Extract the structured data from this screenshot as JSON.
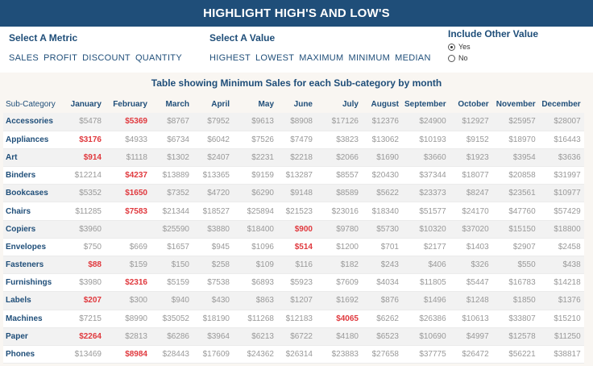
{
  "banner": {
    "title": "HIGHLIGHT HIGH'S AND LOW'S"
  },
  "metric": {
    "title": "Select A Metric",
    "options": [
      "SALES",
      "PROFIT",
      "DISCOUNT",
      "QUANTITY"
    ]
  },
  "value": {
    "title": "Select A Value",
    "options": [
      "HIGHEST",
      "LOWEST",
      "MAXIMUM",
      "MINIMUM",
      "MEDIAN"
    ]
  },
  "other": {
    "title": "Include Other Value",
    "yes": "Yes",
    "no": "No",
    "selected": "Yes"
  },
  "table": {
    "title": "Table showing Minimum Sales for each Sub-category by month",
    "headers": [
      "Sub-Category",
      "January",
      "February",
      "March",
      "April",
      "May",
      "June",
      "July",
      "August",
      "September",
      "October",
      "November",
      "December"
    ],
    "low_color": "#e0393e",
    "rows": [
      {
        "cat": "Accessories",
        "values": [
          "$5478",
          "$5369",
          "$8767",
          "$7952",
          "$9613",
          "$8908",
          "$17126",
          "$12376",
          "$24900",
          "$12927",
          "$25957",
          "$28007"
        ],
        "low": 1
      },
      {
        "cat": "Appliances",
        "values": [
          "$3176",
          "$4933",
          "$6734",
          "$6042",
          "$7526",
          "$7479",
          "$3823",
          "$13062",
          "$10193",
          "$9152",
          "$18970",
          "$16443"
        ],
        "low": 0
      },
      {
        "cat": "Art",
        "values": [
          "$914",
          "$1118",
          "$1302",
          "$2407",
          "$2231",
          "$2218",
          "$2066",
          "$1690",
          "$3660",
          "$1923",
          "$3954",
          "$3636"
        ],
        "low": 0
      },
      {
        "cat": "Binders",
        "values": [
          "$12214",
          "$4237",
          "$13889",
          "$13365",
          "$9159",
          "$13287",
          "$8557",
          "$20430",
          "$37344",
          "$18077",
          "$20858",
          "$31997"
        ],
        "low": 1
      },
      {
        "cat": "Bookcases",
        "values": [
          "$5352",
          "$1650",
          "$7352",
          "$4720",
          "$6290",
          "$9148",
          "$8589",
          "$5622",
          "$23373",
          "$8247",
          "$23561",
          "$10977"
        ],
        "low": 1
      },
      {
        "cat": "Chairs",
        "values": [
          "$11285",
          "$7583",
          "$21344",
          "$18527",
          "$25894",
          "$21523",
          "$23016",
          "$18340",
          "$51577",
          "$24170",
          "$47760",
          "$57429"
        ],
        "low": 1
      },
      {
        "cat": "Copiers",
        "values": [
          "$3960",
          "",
          "$25590",
          "$3880",
          "$18400",
          "$900",
          "$9780",
          "$5730",
          "$10320",
          "$37020",
          "$15150",
          "$18800"
        ],
        "low": 5
      },
      {
        "cat": "Envelopes",
        "values": [
          "$750",
          "$669",
          "$1657",
          "$945",
          "$1096",
          "$514",
          "$1200",
          "$701",
          "$2177",
          "$1403",
          "$2907",
          "$2458"
        ],
        "low": 5
      },
      {
        "cat": "Fasteners",
        "values": [
          "$88",
          "$159",
          "$150",
          "$258",
          "$109",
          "$116",
          "$182",
          "$243",
          "$406",
          "$326",
          "$550",
          "$438"
        ],
        "low": 0
      },
      {
        "cat": "Furnishings",
        "values": [
          "$3980",
          "$2316",
          "$5159",
          "$7538",
          "$6893",
          "$5923",
          "$7609",
          "$4034",
          "$11805",
          "$5447",
          "$16783",
          "$14218"
        ],
        "low": 1
      },
      {
        "cat": "Labels",
        "values": [
          "$207",
          "$300",
          "$940",
          "$430",
          "$863",
          "$1207",
          "$1692",
          "$876",
          "$1496",
          "$1248",
          "$1850",
          "$1376"
        ],
        "low": 0
      },
      {
        "cat": "Machines",
        "values": [
          "$7215",
          "$8990",
          "$35052",
          "$18190",
          "$11268",
          "$12183",
          "$4065",
          "$6262",
          "$26386",
          "$10613",
          "$33807",
          "$15210"
        ],
        "low": 6
      },
      {
        "cat": "Paper",
        "values": [
          "$2264",
          "$2813",
          "$6286",
          "$3964",
          "$6213",
          "$6722",
          "$4180",
          "$6523",
          "$10690",
          "$4997",
          "$12578",
          "$11250"
        ],
        "low": 0
      },
      {
        "cat": "Phones",
        "values": [
          "$13469",
          "$8984",
          "$28443",
          "$17609",
          "$24362",
          "$26314",
          "$23883",
          "$27658",
          "$37775",
          "$26472",
          "$56221",
          "$38817"
        ],
        "low": 1
      }
    ]
  }
}
